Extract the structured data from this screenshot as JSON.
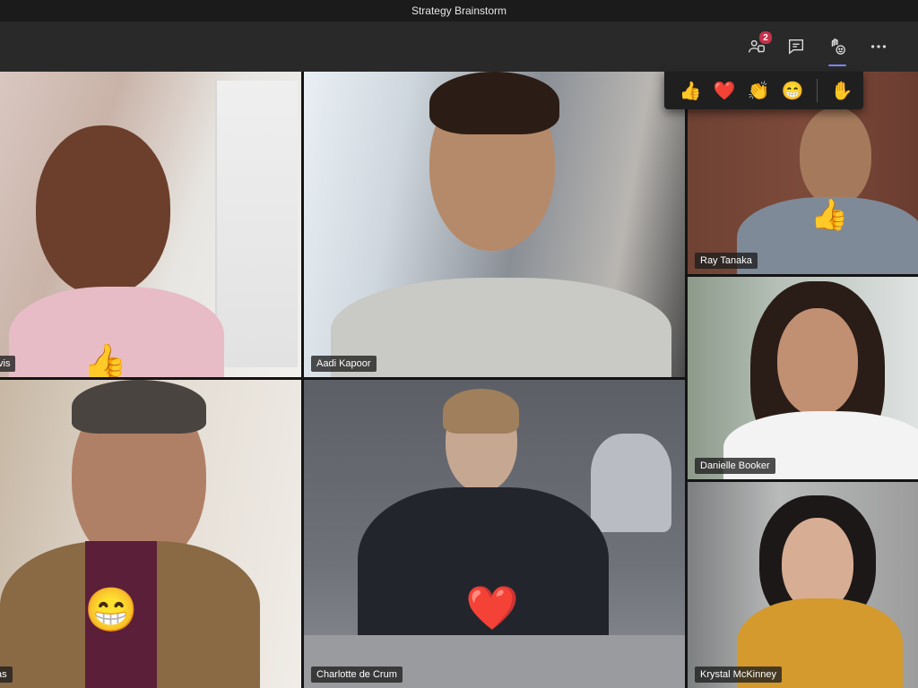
{
  "window": {
    "title": "Strategy Brainstorm"
  },
  "toolbar": {
    "participants_badge": "2"
  },
  "reactions_bar": {
    "items": [
      "👍",
      "❤️",
      "👏",
      "😁"
    ],
    "raise_hand": "✋"
  },
  "tiles": [
    {
      "name": "vis",
      "reaction": "👍"
    },
    {
      "name": "Aadi Kapoor"
    },
    {
      "name": "Ray Tanaka",
      "reaction": "👍"
    },
    {
      "name": "Danielle Booker"
    },
    {
      "name": "as",
      "reaction": "😁"
    },
    {
      "name": "Charlotte de Crum",
      "reaction": "❤️"
    },
    {
      "name": "Krystal McKinney"
    }
  ],
  "colors": {
    "speaker_border": "#e6a642",
    "accent": "#7f85f5",
    "badge": "#c4314b"
  }
}
